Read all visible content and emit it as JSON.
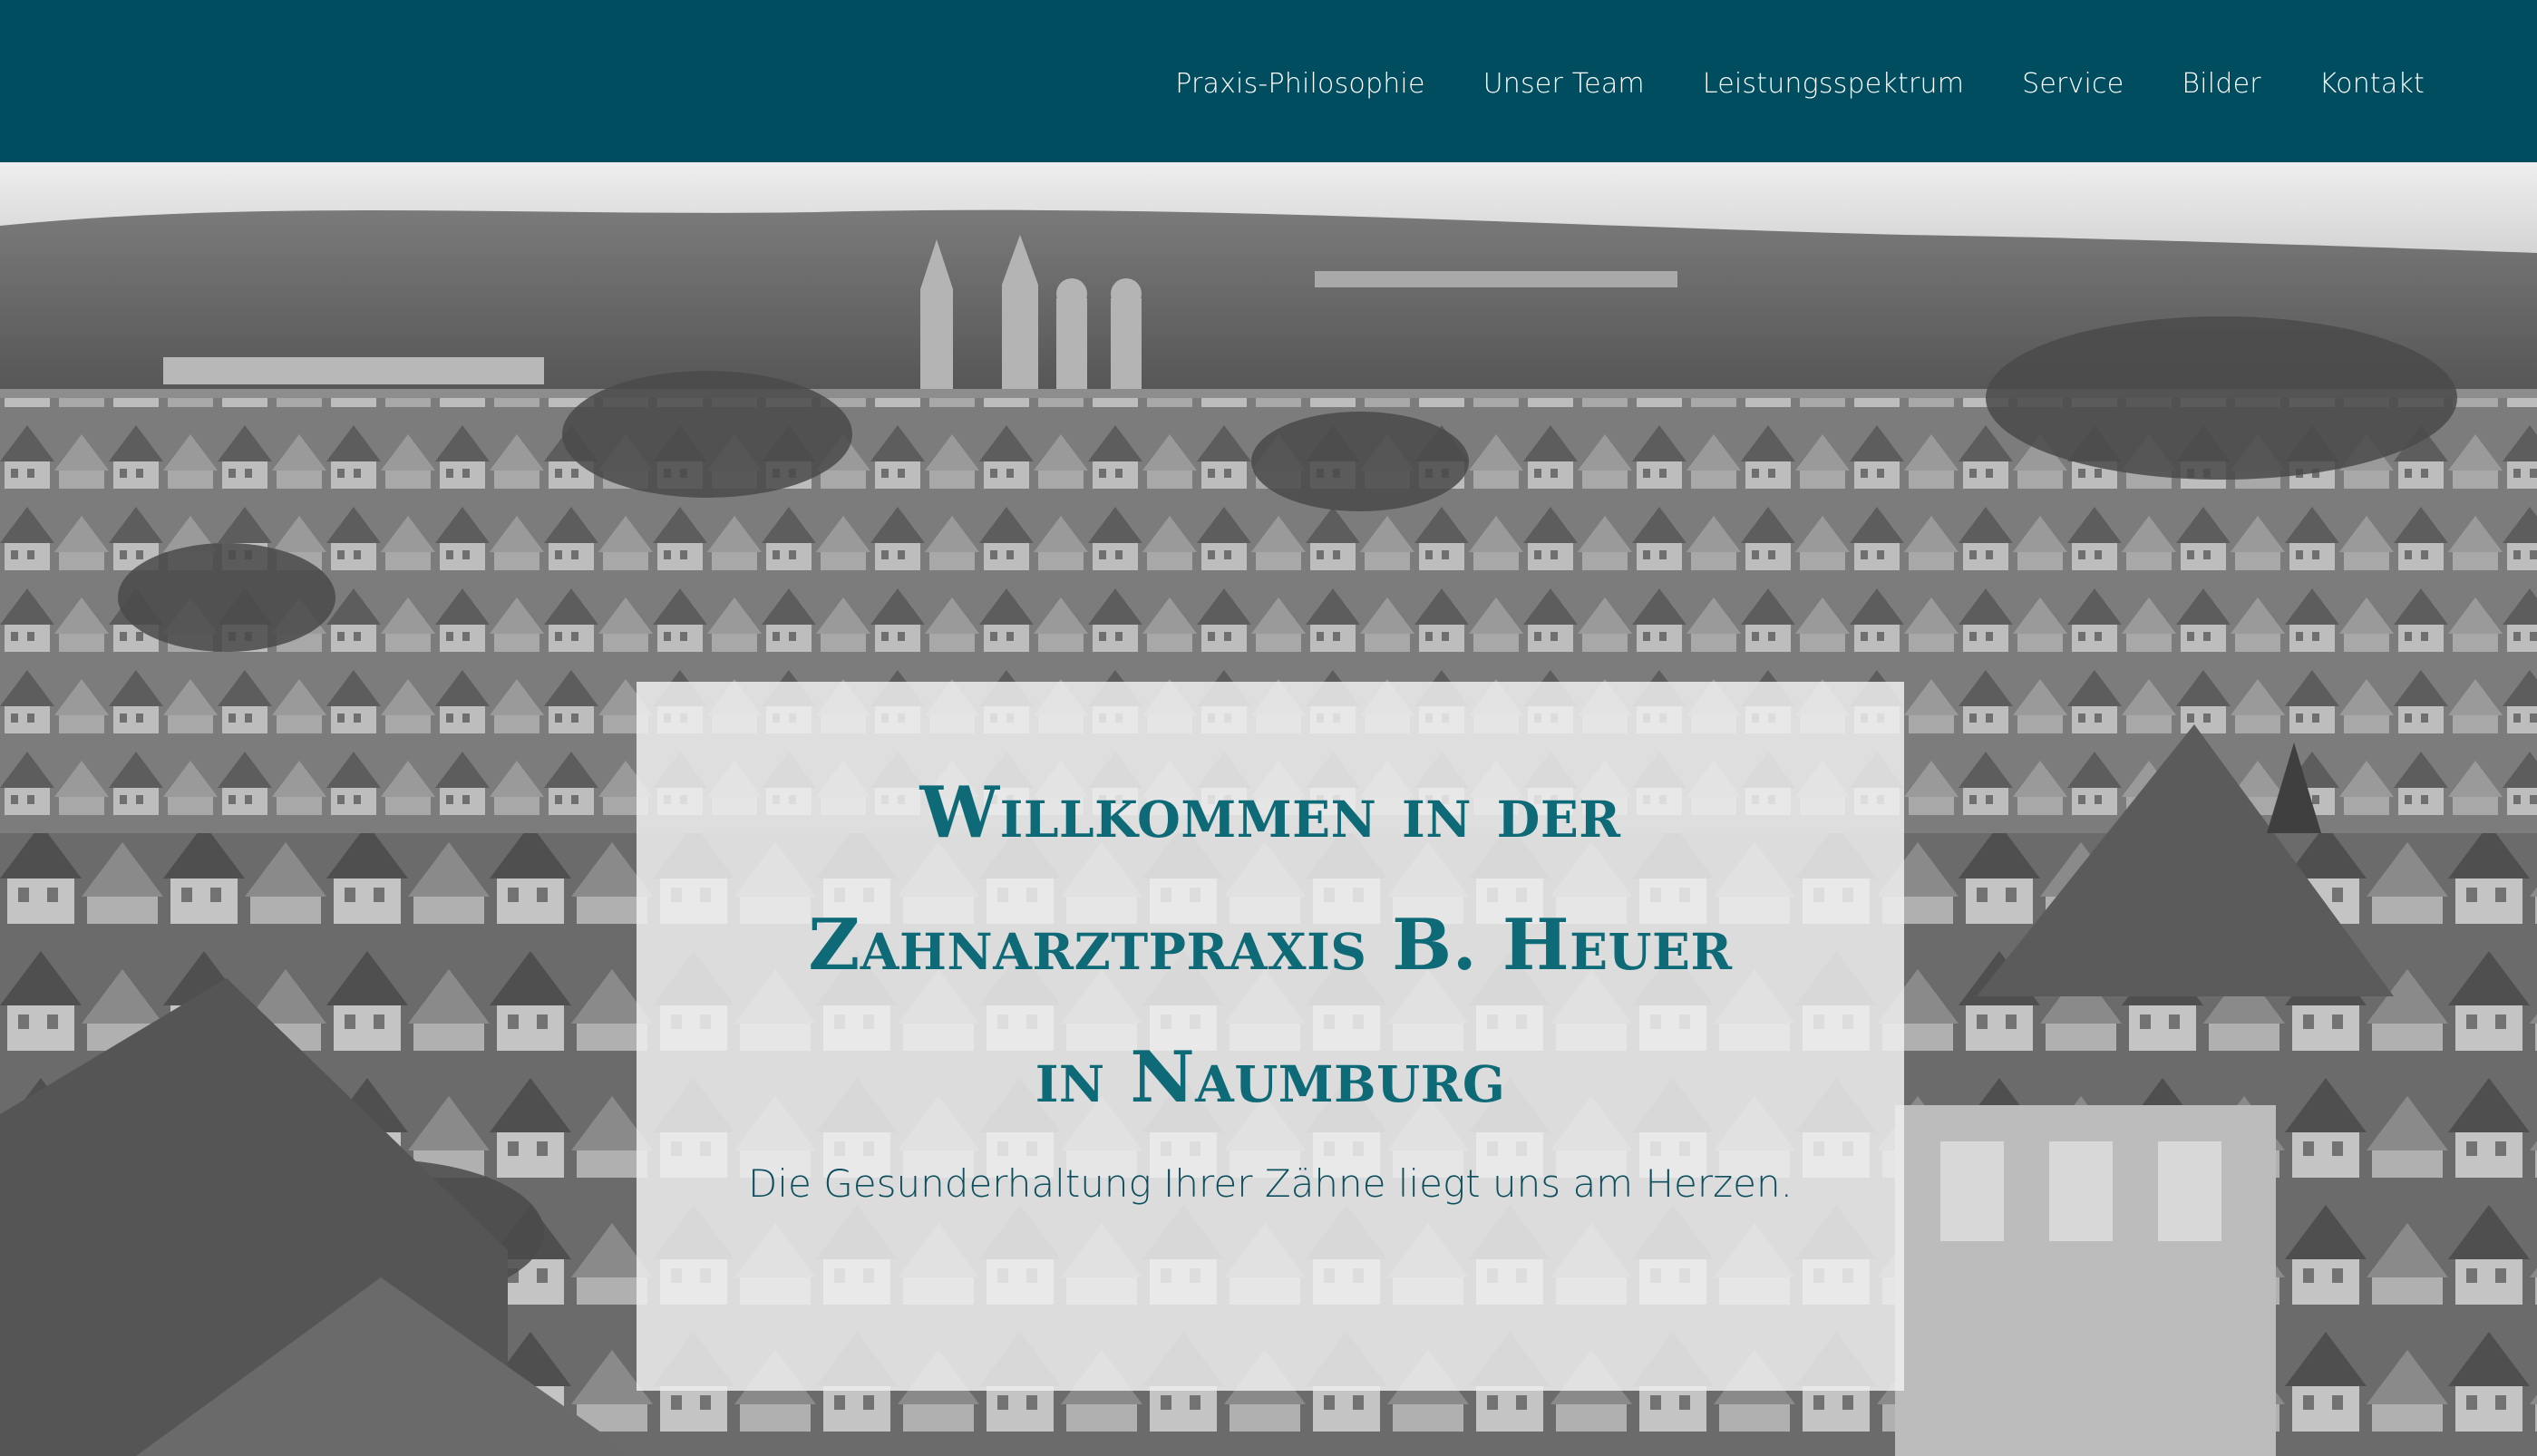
{
  "nav": {
    "items": [
      {
        "label": "Praxis-Philosophie"
      },
      {
        "label": "Unser Team"
      },
      {
        "label": "Leistungsspektrum"
      },
      {
        "label": "Service"
      },
      {
        "label": "Bilder"
      },
      {
        "label": "Kontakt"
      }
    ]
  },
  "hero": {
    "title_line1": "Willkommen in der",
    "title_line2": "Zahnarztpraxis B. Heuer",
    "title_line3": "in Naumburg",
    "subtitle": "Die Gesunderhaltung Ihrer Zähne liegt uns am Herzen."
  },
  "colors": {
    "nav_background": "#004d5f",
    "title_color": "#0f6a78",
    "subtitle_color": "#0d4f5e",
    "box_background": "#f0f0f0"
  }
}
